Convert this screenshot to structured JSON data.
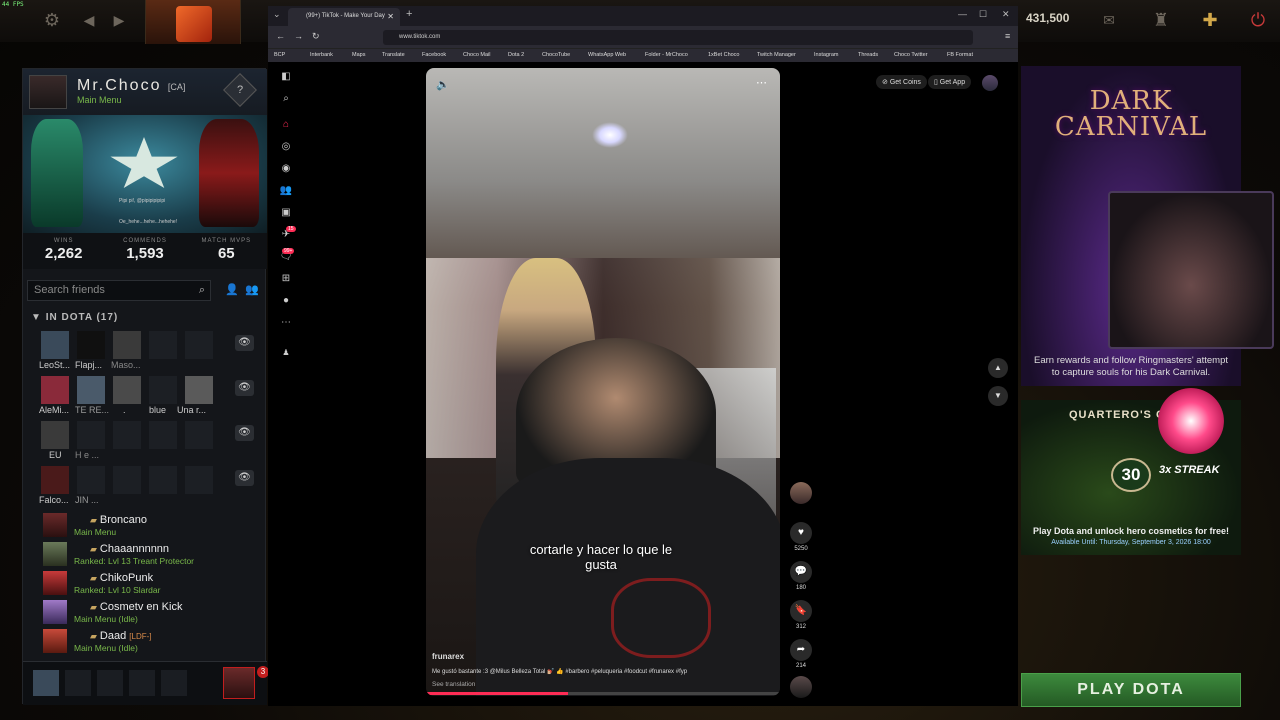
{
  "fps": "44 FPS",
  "gold": "431,500",
  "profile": {
    "name": "Mr.Choco",
    "tag": "[CA]",
    "status": "Main Menu",
    "banner_line1": "Pipi pi!, @pipipipipipi",
    "banner_line2": "Oe_hehe...hehe...hehehe!",
    "stats": [
      {
        "label": "WINS",
        "value": "2,262"
      },
      {
        "label": "COMMENDS",
        "value": "1,593"
      },
      {
        "label": "MATCH MVPS",
        "value": "65"
      }
    ]
  },
  "friends": {
    "search_placeholder": "Search friends",
    "in_dota_header": "IN DOTA (17)",
    "grid_rows": [
      [
        "LeoSt...",
        "Flapj...",
        "Maso..."
      ],
      [
        "AleMi...",
        "TE RE...",
        ".",
        "blue",
        "Una r..."
      ],
      [
        "EU",
        "H e ..."
      ],
      [
        "Falco...",
        "JIN ..."
      ]
    ],
    "list": [
      {
        "name": "Broncano",
        "status": "Main Menu",
        "ldf": ""
      },
      {
        "name": "Chaaannnnnn",
        "status": "Ranked: Lvl 13 Treant Protector",
        "ldf": ""
      },
      {
        "name": "ChikoPunk",
        "status": "Ranked: Lvl 10 Slardar",
        "ldf": ""
      },
      {
        "name": "Cosmetv en Kick",
        "status": "Main Menu (Idle)",
        "ldf": ""
      },
      {
        "name": "Daad",
        "status": "Main Menu (Idle)",
        "ldf": "[LDF-]"
      }
    ],
    "party_badge": "3"
  },
  "browser": {
    "tab_title": "(99+) TikTok - Make Your Day",
    "url": "www.tiktok.com",
    "bookmarks": [
      "BCP",
      "Interbank",
      "Maps",
      "Translate",
      "Facebook",
      "Choco Mail",
      "Dota 2",
      "ChocoTube",
      "WhatsApp Web",
      "Folder - MrChoco",
      "1xBet Choco",
      "Twitch Manager",
      "Instagram",
      "Threads",
      "Choco Twitter",
      "FB Format"
    ]
  },
  "tiktok": {
    "get_coins": "Get Coins",
    "get_app": "Get App",
    "caption": "cortarle y hacer lo que le gusta",
    "username": "frunarex",
    "description": "Me gustó bastante :3 @Milus Belleza Total 💅🏼 👍 #barbero #peluqueria #foodcut #frunarex #fyp",
    "see_translation": "See translation",
    "likes": "5250",
    "comments": "180",
    "saves": "312",
    "shares": "214",
    "inbox_badge": "15",
    "notif_badge": "99+"
  },
  "event": {
    "title": "DARK CARNIVAL",
    "description": "Earn rewards and follow Ringmasters' attempt to capture souls for his Dark Carnival."
  },
  "quest": {
    "title": "QUARTERO'S CH...",
    "streak_number": "30",
    "streak_label": "3x STREAK",
    "description": "Play Dota and unlock hero cosmetics for free!",
    "available": "Available Until: Thursday, September 3, 2026 18:00"
  },
  "play_button": "PLAY DOTA"
}
